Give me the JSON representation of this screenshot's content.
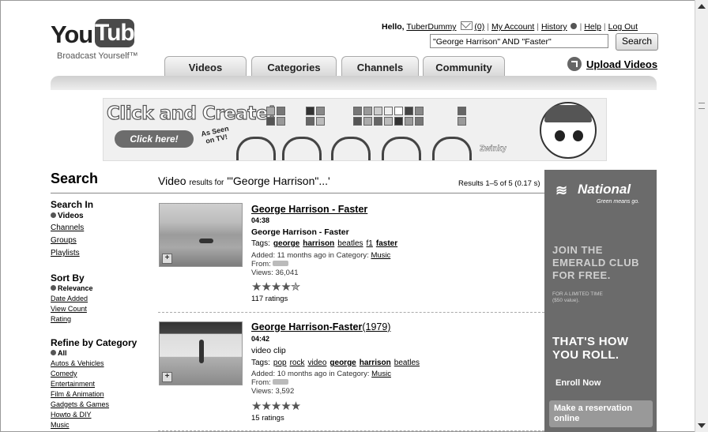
{
  "header": {
    "logo_you": "You",
    "logo_tube": "Tube",
    "tagline": "Broadcast Yourself™",
    "greeting": "Hello,",
    "username": "TuberDummy",
    "mail_count": "(0)",
    "my_account": "My Account",
    "history": "History",
    "help": "Help",
    "logout": "Log Out",
    "search_value": "\"George Harrison\" AND \"Faster\"",
    "search_button": "Search",
    "tabs": [
      "Videos",
      "Categories",
      "Channels",
      "Community"
    ],
    "upload": "Upload Videos"
  },
  "banner": {
    "title": "Click and Create!",
    "button": "Click here!",
    "as_seen": "As Seen on TV!",
    "brand": "Zwinky"
  },
  "sidebar": {
    "heading": "Search",
    "search_in": {
      "title": "Search In",
      "selected": "Videos",
      "options": [
        "Channels",
        "Groups",
        "Playlists"
      ]
    },
    "sort_by": {
      "title": "Sort By",
      "selected": "Relevance",
      "options": [
        "Date Added",
        "View Count",
        "Rating"
      ]
    },
    "refine": {
      "title": "Refine by Category",
      "selected": "All",
      "options": [
        "Autos & Vehicles",
        "Comedy",
        "Entertainment",
        "Film & Animation",
        "Gadgets & Games",
        "Howto & DIY",
        "Music"
      ]
    }
  },
  "results": {
    "header_prefix": "Video",
    "header_small": "results for",
    "query": "'\"George Harrison\"...'",
    "count": "Results 1–5 of 5 (0.17 s)",
    "items": [
      {
        "title": "George Harrison - Faster",
        "duration": "04:38",
        "description": "George Harrison - Faster",
        "tags_label": "Tags:",
        "tags": [
          "george",
          "harrison",
          "beatles",
          "f1",
          "faster"
        ],
        "added_label": "Added:",
        "added": "11 months ago",
        "category_label": "in Category:",
        "category": "Music",
        "from_label": "From:",
        "views_label": "Views:",
        "views": "36,041",
        "stars": "★★★★✯",
        "rating_value": 4.5,
        "ratings": "117 ratings"
      },
      {
        "title": "George Harrison-Faster",
        "title_suffix": "(1979)",
        "duration": "04:42",
        "description": "video clip",
        "tags_label": "Tags:",
        "tags": [
          "pop",
          "rock",
          "video",
          "george",
          "harrison",
          "beatles"
        ],
        "added_label": "Added:",
        "added": "10 months ago",
        "category_label": "in Category:",
        "category": "Music",
        "from_label": "From:",
        "views_label": "Views:",
        "views": "3,592",
        "stars": "★★★★★",
        "rating_value": 5,
        "ratings": "15 ratings"
      }
    ]
  },
  "ad": {
    "brand": "National",
    "tagline": "Green means go.",
    "headline": "JOIN THE EMERALD CLUB FOR FREE.",
    "fine_print": "FOR A LIMITED TIME ($50 value).",
    "slogan": "THAT'S HOW YOU ROLL.",
    "enroll": "Enroll Now",
    "reserve": "Make a reservation online"
  }
}
